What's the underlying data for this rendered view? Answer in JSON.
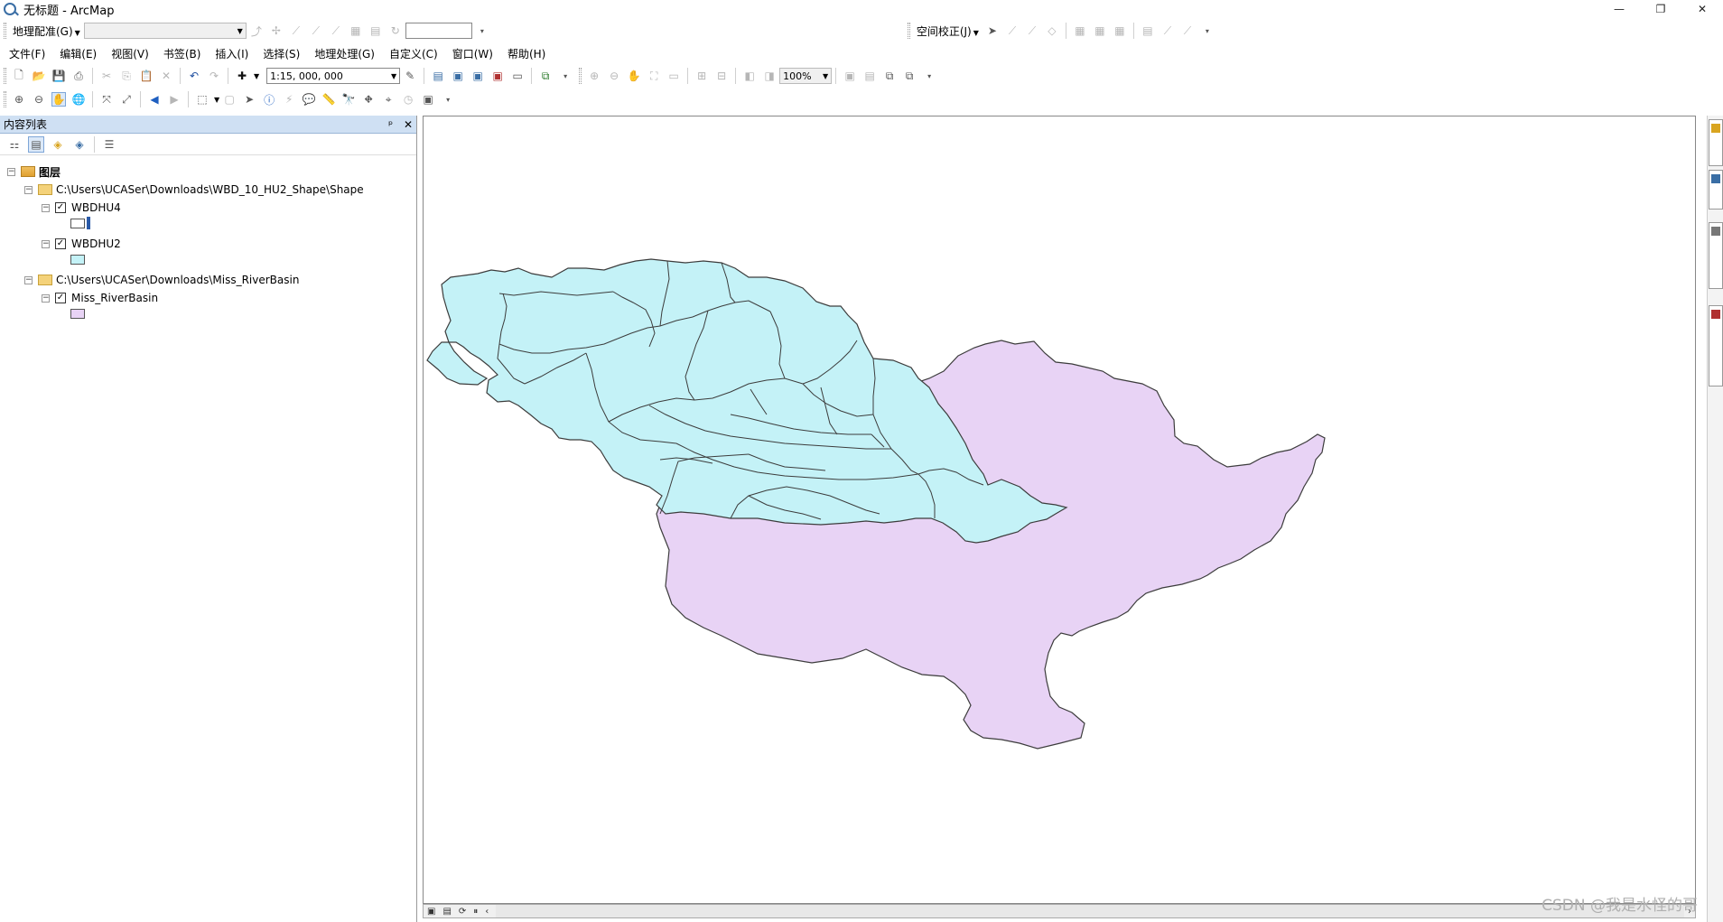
{
  "window": {
    "title": "无标题 - ArcMap",
    "controls": [
      "—",
      "❐",
      "✕"
    ]
  },
  "georef_toolbar": {
    "label": "地理配准(G)",
    "spatial_adjust_label": "空间校正(J)"
  },
  "menubar": {
    "items": [
      "文件(F)",
      "编辑(E)",
      "视图(V)",
      "书签(B)",
      "插入(I)",
      "选择(S)",
      "地理处理(G)",
      "自定义(C)",
      "窗口(W)",
      "帮助(H)"
    ]
  },
  "standard_toolbar": {
    "scale": "1:15, 000, 000",
    "zoom_percent": "100%"
  },
  "toc": {
    "title": "内容列表",
    "pin": "ᵖ",
    "close": "✕",
    "root_label": "图层",
    "groups": [
      {
        "path": "C:\\Users\\UCASer\\Downloads\\WBD_10_HU2_Shape\\Shape",
        "layers": [
          {
            "name": "WBDHU4",
            "checked": "✓",
            "fill": "#ffffff"
          },
          {
            "name": "WBDHU2",
            "checked": "✓",
            "fill": "#c4f2f7"
          }
        ]
      },
      {
        "path": "C:\\Users\\UCASer\\Downloads\\Miss_RiverBasin",
        "layers": [
          {
            "name": "Miss_RiverBasin",
            "checked": "✓",
            "fill": "#e8d3f5"
          }
        ]
      }
    ]
  },
  "colors": {
    "basin_fill": "#e8d3f5",
    "hu_fill": "#c4f2f7",
    "outline": "#3c3c3c",
    "toc_header": "#cfe0f3"
  },
  "watermark": "CSDN @我是水怪的哥"
}
